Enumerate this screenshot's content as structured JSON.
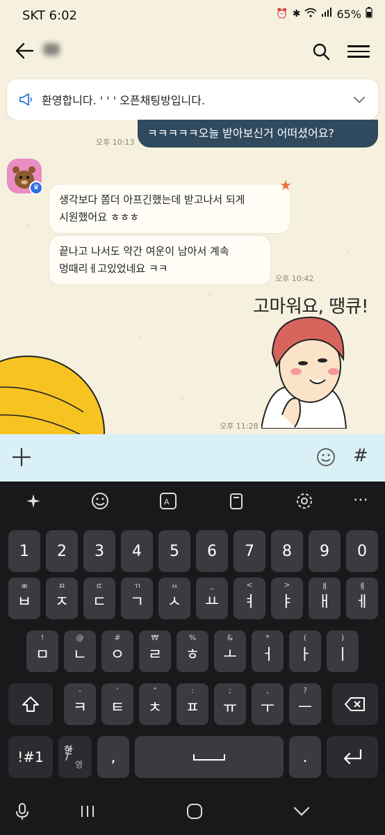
{
  "status": {
    "carrier": "SKT 6:02",
    "battery": "65%"
  },
  "header": {
    "title_redacted": ""
  },
  "notice": {
    "text": "환영합니다. ' ' ' 오픈채팅방입니다."
  },
  "chat": {
    "messages": [
      {
        "id": "out1",
        "text": "ㅋㅋㅋㅋㅋ오늘 받아보신거 어떠셨어요?",
        "time": "오후 10:13"
      },
      {
        "id": "in1",
        "text": [
          "생각보다 쫌더 아프긴했는데 받고나서 되게",
          "시원했어요 ㅎㅎㅎ"
        ]
      },
      {
        "id": "in2",
        "text": [
          "끝나고 나서도 약간 여운이 남아서 계속",
          "멍때리ㅔ고있었네요 ㅋㅋ"
        ],
        "time": "오후 10:42"
      },
      {
        "id": "sticker",
        "text": "고마워요, 땡큐!",
        "time": "오후 11:28"
      }
    ]
  },
  "keyboard": {
    "numbers": [
      "1",
      "2",
      "3",
      "4",
      "5",
      "6",
      "7",
      "8",
      "9",
      "0"
    ],
    "row1": [
      {
        "sup": "ㅃ",
        "main": "ㅂ"
      },
      {
        "sup": "ㅉ",
        "main": "ㅈ"
      },
      {
        "sup": "ㄸ",
        "main": "ㄷ"
      },
      {
        "sup": "ㄲ",
        "main": "ㄱ"
      },
      {
        "sup": "ㅆ",
        "main": "ㅅ"
      },
      {
        "sup": "_",
        "main": "ㅛ"
      },
      {
        "sup": "<",
        "main": "ㅕ"
      },
      {
        "sup": ">",
        "main": "ㅑ"
      },
      {
        "sup": "ㅒ",
        "main": "ㅐ"
      },
      {
        "sup": "ㅖ",
        "main": "ㅔ"
      }
    ],
    "row2": [
      {
        "sup": "!",
        "main": "ㅁ"
      },
      {
        "sup": "@",
        "main": "ㄴ"
      },
      {
        "sup": "#",
        "main": "ㅇ"
      },
      {
        "sup": "₩",
        "main": "ㄹ"
      },
      {
        "sup": "%",
        "main": "ㅎ"
      },
      {
        "sup": "&",
        "main": "ㅗ"
      },
      {
        "sup": "*",
        "main": "ㅓ"
      },
      {
        "sup": "(",
        "main": "ㅏ"
      },
      {
        "sup": ")",
        "main": "ㅣ"
      }
    ],
    "row3": [
      {
        "sup": "-",
        "main": "ㅋ"
      },
      {
        "sup": "'",
        "main": "ㅌ"
      },
      {
        "sup": "\"",
        "main": "ㅊ"
      },
      {
        "sup": ":",
        "main": "ㅍ"
      },
      {
        "sup": ";",
        "main": "ㅠ"
      },
      {
        "sup": ",",
        "main": "ㅜ"
      },
      {
        "sup": "?",
        "main": "ㅡ"
      }
    ],
    "bottom": {
      "symbols": "!#1",
      "lang_top": "한",
      "lang_bottom": "영",
      "comma": ",",
      "period": "."
    }
  },
  "colors": {
    "chat_bg": "#f6f1df",
    "outgoing": "#2f4a5f",
    "input_bar": "#d9f0f6",
    "keyboard_bg": "#18191b"
  }
}
